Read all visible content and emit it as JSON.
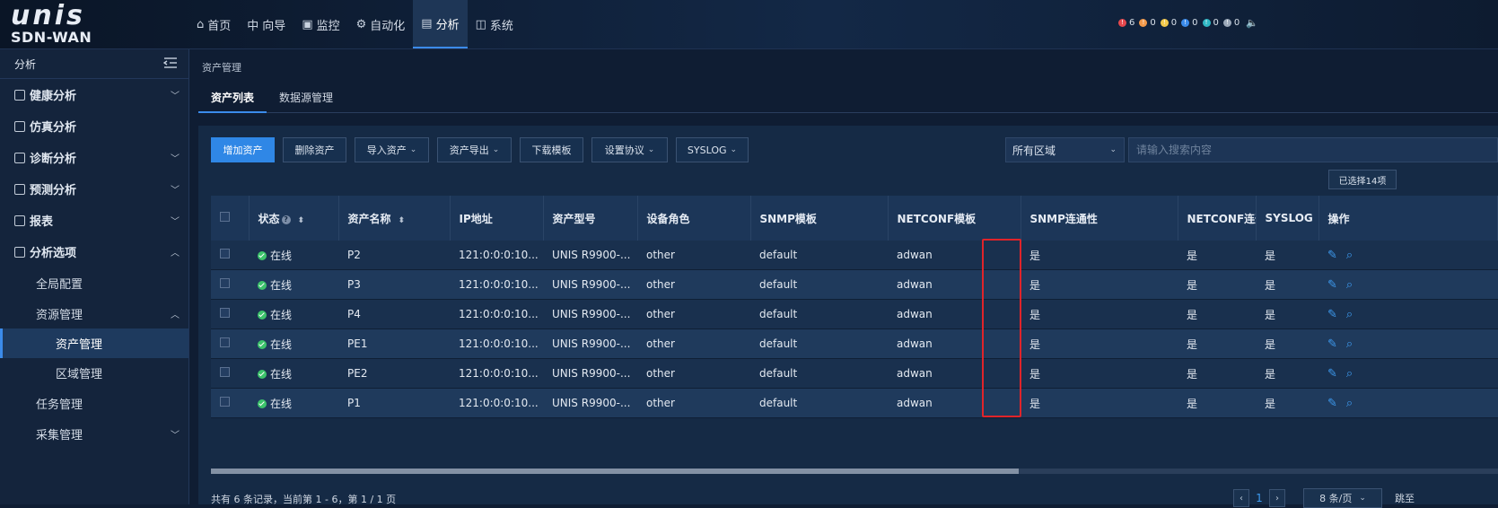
{
  "brand": {
    "logo": "unis",
    "product": "SDN-WAN"
  },
  "nav": [
    {
      "label": "首页",
      "icon": "⌂"
    },
    {
      "label": "向导",
      "icon": "中"
    },
    {
      "label": "监控",
      "icon": "▣"
    },
    {
      "label": "自动化",
      "icon": "⚙"
    },
    {
      "label": "分析",
      "icon": "▤"
    },
    {
      "label": "系统",
      "icon": "◫"
    }
  ],
  "alarms": [
    {
      "count": "6",
      "color": "#e5484d"
    },
    {
      "count": "0",
      "color": "#f2994a"
    },
    {
      "count": "0",
      "color": "#f2c94c"
    },
    {
      "count": "0",
      "color": "#3b8bea"
    },
    {
      "count": "0",
      "color": "#2fb7c4"
    },
    {
      "count": "0",
      "color": "#9aa7b8"
    }
  ],
  "sidebar": {
    "title": "分析",
    "items": [
      {
        "label": "健康分析"
      },
      {
        "label": "仿真分析"
      },
      {
        "label": "诊断分析"
      },
      {
        "label": "预测分析"
      },
      {
        "label": "报表"
      },
      {
        "label": "分析选项"
      }
    ],
    "sub": {
      "global": "全局配置",
      "resource": "资源管理",
      "asset": "资产管理",
      "region": "区域管理",
      "task": "任务管理",
      "collect": "采集管理"
    }
  },
  "breadcrumb": "资产管理",
  "tabs": [
    "资产列表",
    "数据源管理"
  ],
  "toolbar": {
    "add": "增加资产",
    "delete": "删除资产",
    "import": "导入资产",
    "export": "资产导出",
    "download": "下载模板",
    "protocol": "设置协议",
    "syslog": "SYSLOG"
  },
  "region_select": "所有区域",
  "search": {
    "placeholder": "请输入搜索内容"
  },
  "selected": "已选择14项",
  "table": {
    "headers": [
      "状态",
      "资产名称",
      "IP地址",
      "资产型号",
      "设备角色",
      "SNMP模板",
      "NETCONF模板",
      "SNMP连通性",
      "NETCONF连通性",
      "SYSLOG",
      "操作"
    ],
    "rows": [
      {
        "status": "在线",
        "name": "P2",
        "ip": "121:0:0:0:10...",
        "model": "UNIS R9900-...",
        "role": "other",
        "snmp_tpl": "default",
        "netconf_tpl": "adwan",
        "snmp": "是",
        "netconf": "是",
        "syslog": "是"
      },
      {
        "status": "在线",
        "name": "P3",
        "ip": "121:0:0:0:10...",
        "model": "UNIS R9900-...",
        "role": "other",
        "snmp_tpl": "default",
        "netconf_tpl": "adwan",
        "snmp": "是",
        "netconf": "是",
        "syslog": "是"
      },
      {
        "status": "在线",
        "name": "P4",
        "ip": "121:0:0:0:10...",
        "model": "UNIS R9900-...",
        "role": "other",
        "snmp_tpl": "default",
        "netconf_tpl": "adwan",
        "snmp": "是",
        "netconf": "是",
        "syslog": "是"
      },
      {
        "status": "在线",
        "name": "PE1",
        "ip": "121:0:0:0:10...",
        "model": "UNIS R9900-...",
        "role": "other",
        "snmp_tpl": "default",
        "netconf_tpl": "adwan",
        "snmp": "是",
        "netconf": "是",
        "syslog": "是"
      },
      {
        "status": "在线",
        "name": "PE2",
        "ip": "121:0:0:0:10...",
        "model": "UNIS R9900-...",
        "role": "other",
        "snmp_tpl": "default",
        "netconf_tpl": "adwan",
        "snmp": "是",
        "netconf": "是",
        "syslog": "是"
      },
      {
        "status": "在线",
        "name": "P1",
        "ip": "121:0:0:0:10...",
        "model": "UNIS R9900-...",
        "role": "other",
        "snmp_tpl": "default",
        "netconf_tpl": "adwan",
        "snmp": "是",
        "netconf": "是",
        "syslog": "是"
      }
    ]
  },
  "pager": {
    "info": "共有 6 条记录，当前第 1 - 6，第 1 / 1 页",
    "page": "1",
    "size": "8 条/页",
    "jump": "跳至"
  },
  "colors": {
    "accent": "#3b8bea",
    "online": "#3cc36b",
    "highlight": "#e0242a"
  }
}
